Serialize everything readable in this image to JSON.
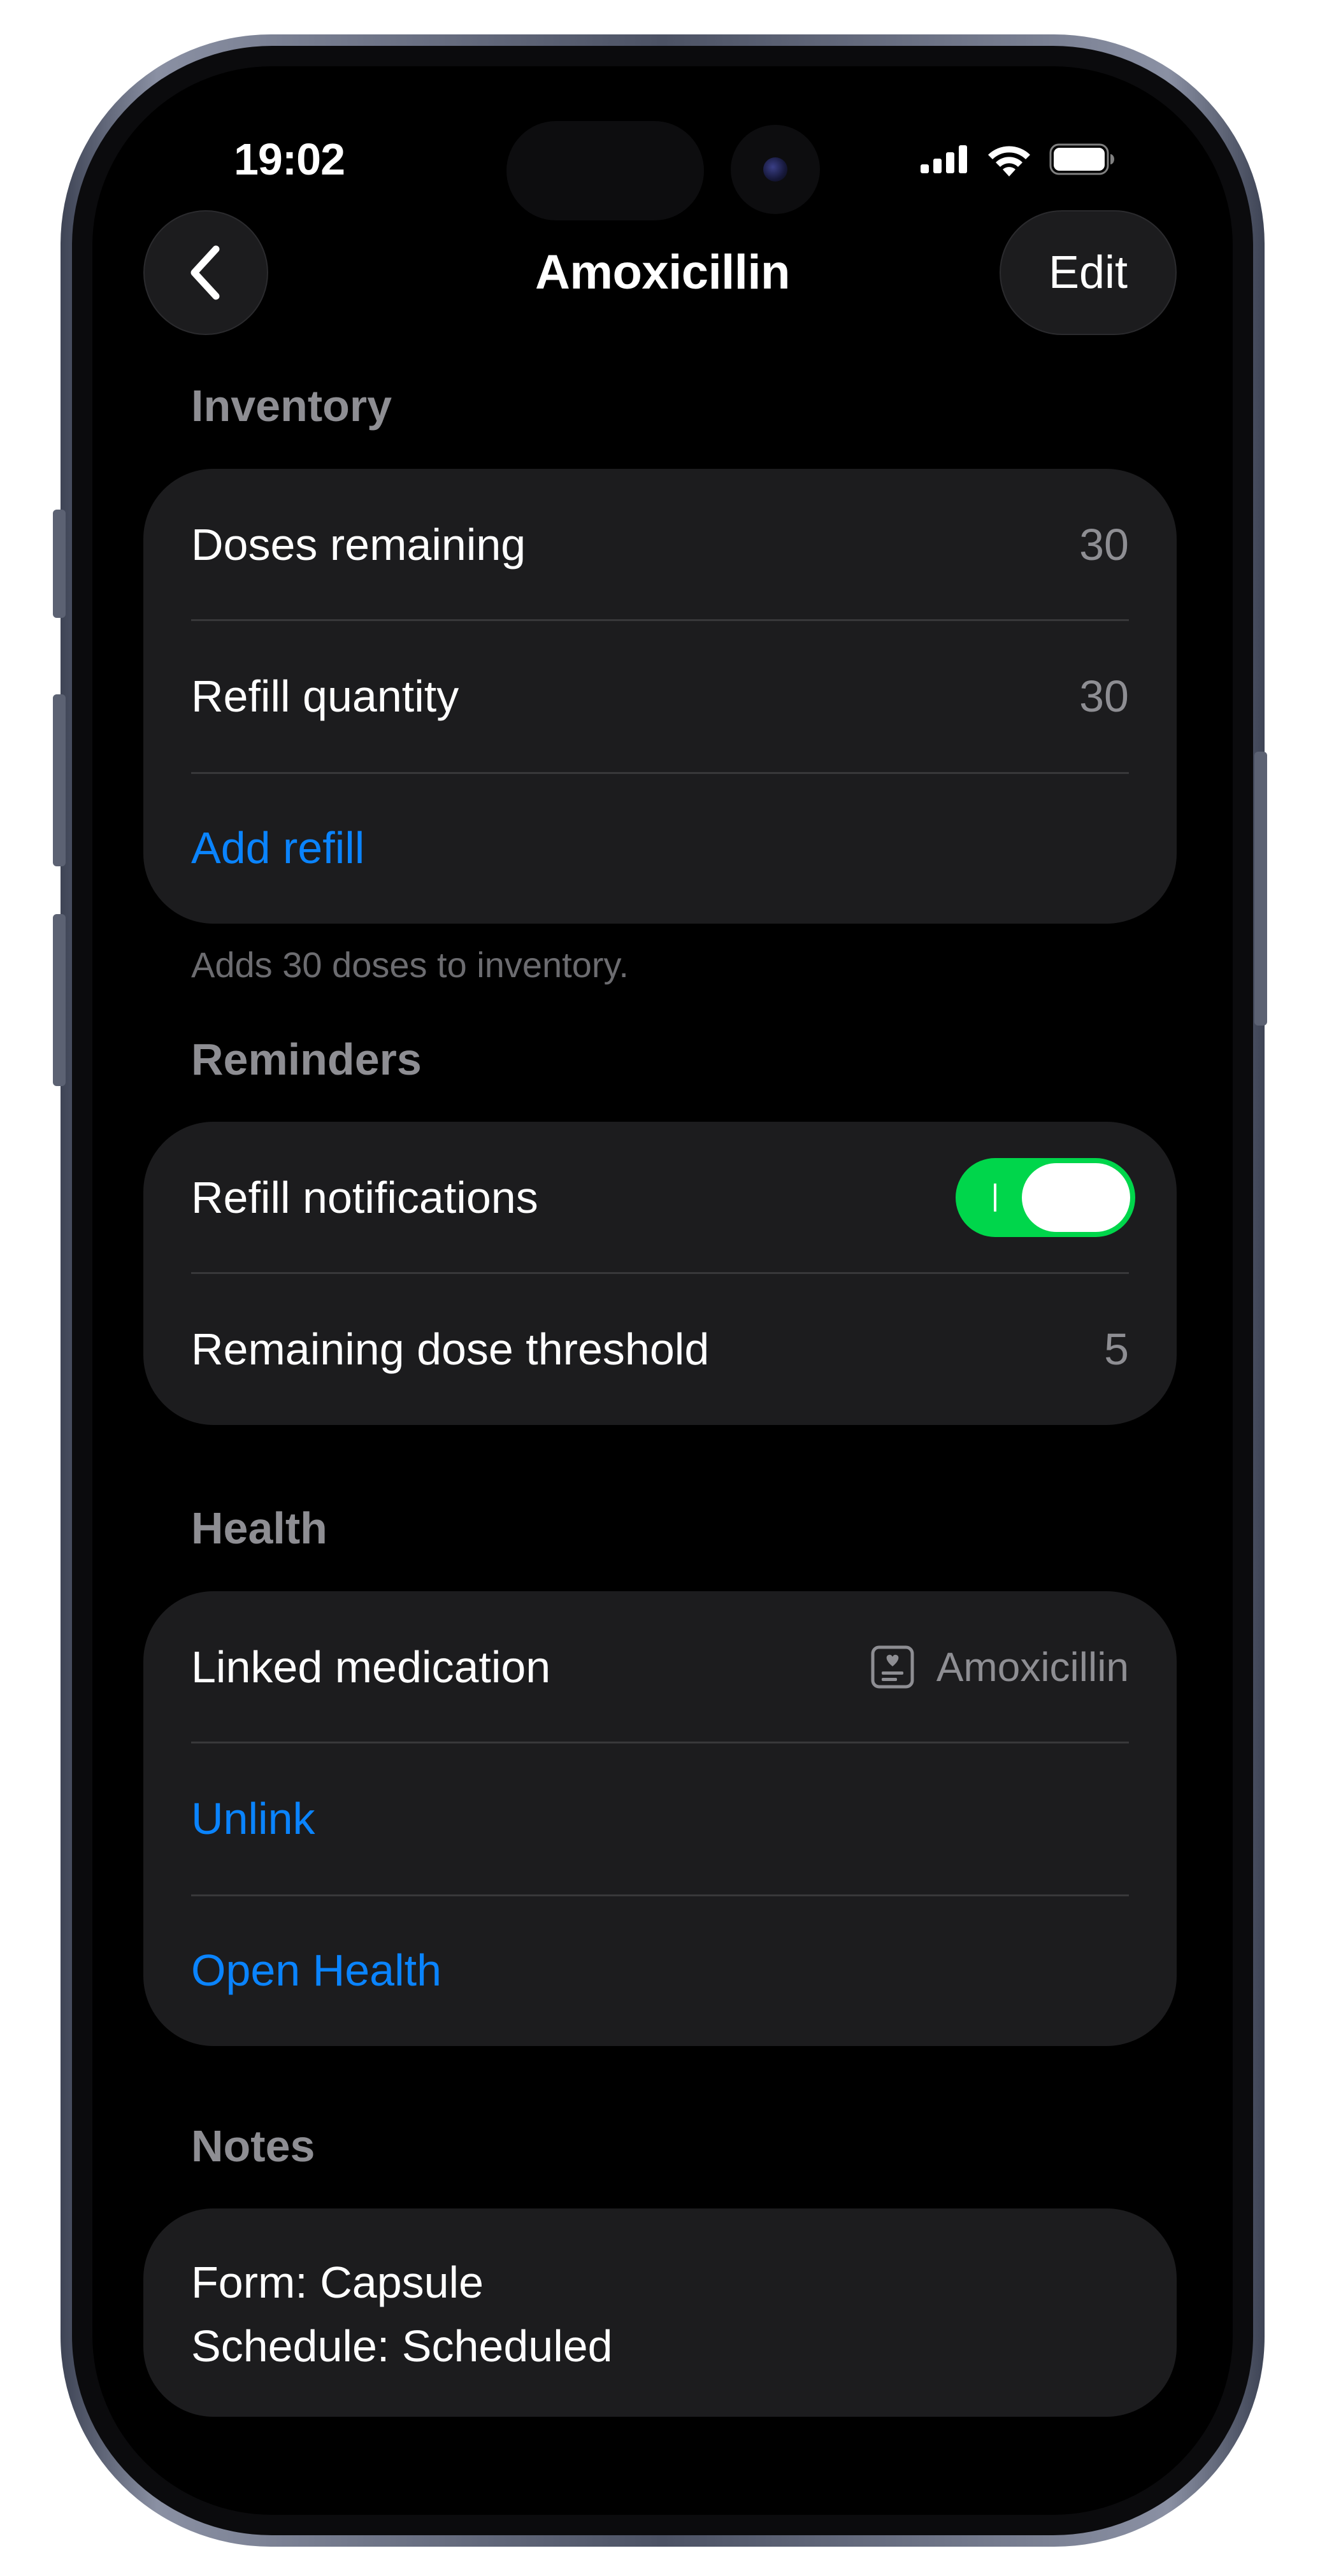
{
  "status_bar": {
    "time": "19:02"
  },
  "nav": {
    "title": "Amoxicillin",
    "edit_label": "Edit"
  },
  "inventory": {
    "header": "Inventory",
    "doses_remaining_label": "Doses remaining",
    "doses_remaining_value": "30",
    "refill_quantity_label": "Refill quantity",
    "refill_quantity_value": "30",
    "add_refill_label": "Add refill",
    "footer": "Adds 30 doses to inventory."
  },
  "reminders": {
    "header": "Reminders",
    "refill_notifications_label": "Refill notifications",
    "refill_notifications_on": true,
    "threshold_label": "Remaining dose threshold",
    "threshold_value": "5"
  },
  "health": {
    "header": "Health",
    "linked_label": "Linked medication",
    "linked_value": "Amoxicillin",
    "linked_icon": "medication-card-icon",
    "unlink_label": "Unlink",
    "open_health_label": "Open Health"
  },
  "notes": {
    "header": "Notes",
    "line1": "Form: Capsule",
    "line2": "Schedule: Scheduled"
  },
  "colors": {
    "accent": "#0a84ff",
    "toggle_on": "#00d64b",
    "card": "#1c1c1e",
    "secondary_text": "#8e8e93"
  }
}
